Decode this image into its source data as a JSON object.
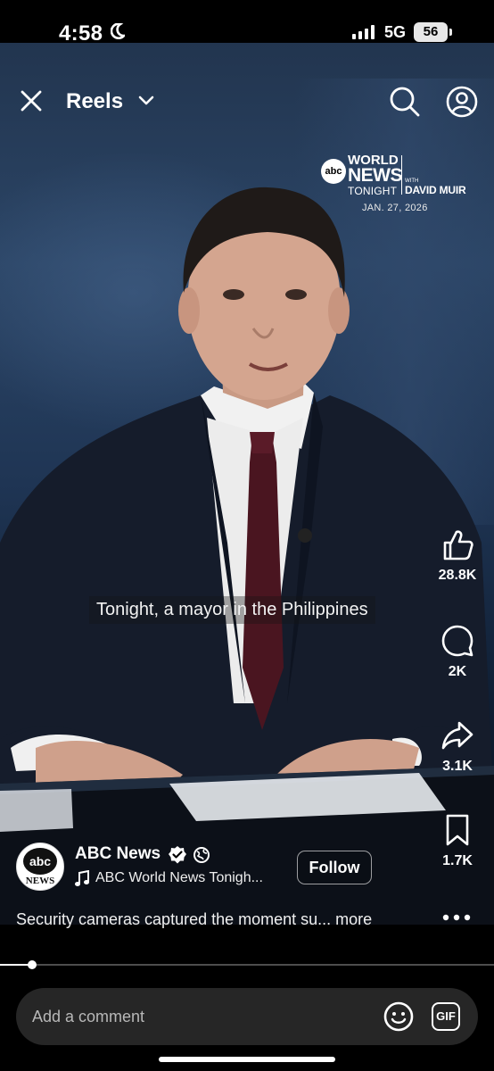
{
  "status_bar": {
    "time": "4:58",
    "network": "5G",
    "battery": "56"
  },
  "header": {
    "title": "Reels"
  },
  "video": {
    "logo": {
      "abc": "abc",
      "world": "WORLD",
      "news": "NEWS",
      "tonight": "TONIGHT",
      "with": "WITH",
      "host": "DAVID MUIR",
      "date": "JAN. 27, 2026"
    },
    "caption": "Tonight, a mayor in the Philippines"
  },
  "actions": {
    "likes": "28.8K",
    "comments": "2K",
    "shares": "3.1K",
    "saves": "1.7K"
  },
  "account": {
    "name": "ABC News",
    "avatar_top": "abc",
    "avatar_bottom": "NEWS",
    "audio": "ABC World News Tonigh...",
    "follow_label": "Follow"
  },
  "description": "Security cameras captured the moment su... more",
  "progress": {
    "fraction": 0.065
  },
  "comment": {
    "placeholder": "Add a comment",
    "gif_label": "GIF"
  },
  "icons": [
    "close-icon",
    "chevron-down-icon",
    "search-icon",
    "profile-icon",
    "like-icon",
    "comment-icon",
    "share-icon",
    "bookmark-icon",
    "verified-icon",
    "globe-icon",
    "music-icon",
    "more-icon",
    "emoji-icon",
    "gif-icon"
  ]
}
